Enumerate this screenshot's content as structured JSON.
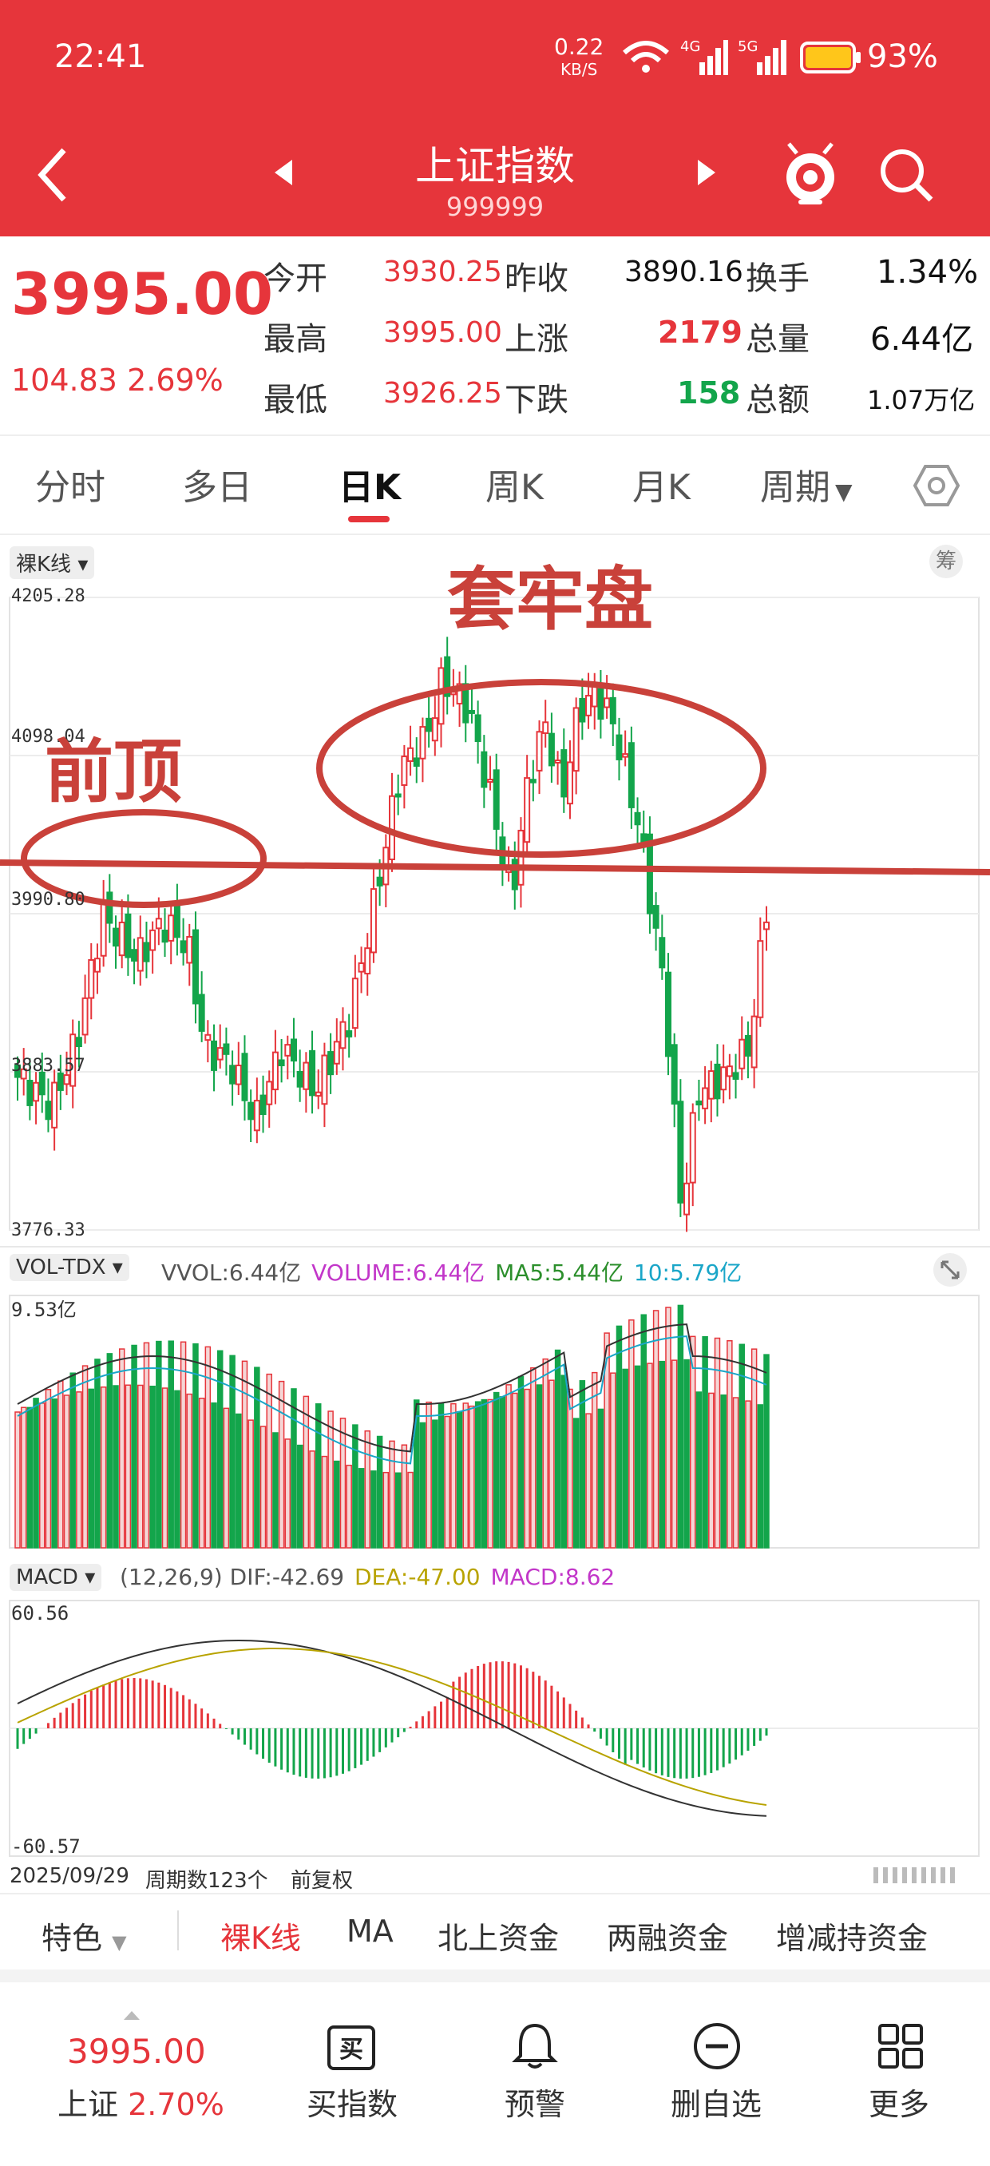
{
  "status_bar": {
    "time": "22:41",
    "net_speed": "0.22",
    "net_unit": "KB/S",
    "net_4g": "4G",
    "net_5g": "5G",
    "battery": "93%"
  },
  "header": {
    "title": "上证指数",
    "code": "999999"
  },
  "quote": {
    "price": "3995.00",
    "change": "104.83",
    "change_pct": "2.69%",
    "rows": [
      {
        "l1": "今开",
        "v1": "3930.25",
        "l2": "昨收",
        "v2": "3890.16",
        "l3": "换手",
        "v3": "1.34%"
      },
      {
        "l1": "最高",
        "v1": "3995.00",
        "l2": "上涨",
        "v2": "2179",
        "l3": "总量",
        "v3": "6.44亿"
      },
      {
        "l1": "最低",
        "v1": "3926.25",
        "l2": "下跌",
        "v2": "158",
        "l3": "总额",
        "v3": "1.07万亿"
      }
    ]
  },
  "period_tabs": [
    "分时",
    "多日",
    "日K",
    "周K",
    "月K",
    "周期"
  ],
  "chart": {
    "kline_label": "裸K线",
    "chip_label": "筹",
    "price_ticks": [
      "4205.28",
      "4098.04",
      "3990.80",
      "3883.57",
      "3776.33"
    ],
    "annotations": {
      "top": "套牢盘",
      "prev_top": "前顶"
    },
    "volume": {
      "label": "VOL-TDX",
      "vvol": "VVOL:6.44亿",
      "volume": "VOLUME:6.44亿",
      "ma5": "MA5:5.44亿",
      "ma10": "10:5.79亿",
      "max_tick": "9.53亿"
    },
    "macd": {
      "label": "MACD",
      "params": "(12,26,9)",
      "dif": "DIF:-42.69",
      "dea": "DEA:-47.00",
      "macd": "MACD:8.62",
      "top_tick": "60.56",
      "bottom_tick": "-60.57"
    },
    "footer": {
      "date": "2025/09/29",
      "periods": "周期数123个",
      "adjust": "前复权"
    }
  },
  "chart_data": {
    "type": "candlestick",
    "ylim": [
      3776.33,
      4205.28
    ],
    "price_ticks": [
      4205.28,
      4098.04,
      3990.8,
      3883.57,
      3776.33
    ],
    "last_close": 3995.0
  },
  "bottom_tabs": [
    "特色",
    "裸K线",
    "MA",
    "北上资金",
    "两融资金",
    "增减持资金"
  ],
  "footer": {
    "price": "3995.00",
    "index_name": "上证",
    "index_pct": "2.70%",
    "nav": [
      "买指数",
      "预警",
      "删自选",
      "更多"
    ],
    "buy_glyph": "买"
  },
  "colors": {
    "red": "#e6353b",
    "green": "#13a54b",
    "annot": "#c9413a"
  }
}
